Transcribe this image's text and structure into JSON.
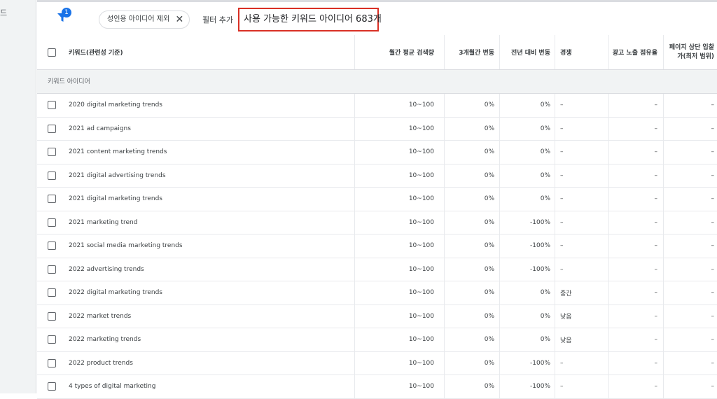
{
  "left_rail": {
    "text": "드"
  },
  "filter_bar": {
    "badge": "1",
    "chip_label": "성인용 아이디어 제외",
    "chip_close": "✕",
    "add_filter": "필터 추가",
    "available_count": "사용 가능한 키워드 아이디어 683개"
  },
  "table": {
    "headers": {
      "keyword": "키워드(관련성 기준)",
      "volume": "월간 평균 검색량",
      "three_month": "3개월간 변동",
      "yoy": "전년 대비 변동",
      "competition": "경쟁",
      "impression_share": "광고 노출 점유율",
      "top_bid": "페이지 상단 입찰가(최저 범위)"
    },
    "group_label": "키워드 아이디어",
    "rows": [
      {
        "keyword": "2020 digital marketing trends",
        "volume": "10~100",
        "three_month": "0%",
        "yoy": "0%",
        "competition": "–",
        "share": "–",
        "bid": "–"
      },
      {
        "keyword": "2021 ad campaigns",
        "volume": "10~100",
        "three_month": "0%",
        "yoy": "0%",
        "competition": "–",
        "share": "–",
        "bid": "–"
      },
      {
        "keyword": "2021 content marketing trends",
        "volume": "10~100",
        "three_month": "0%",
        "yoy": "0%",
        "competition": "–",
        "share": "–",
        "bid": "–"
      },
      {
        "keyword": "2021 digital advertising trends",
        "volume": "10~100",
        "three_month": "0%",
        "yoy": "0%",
        "competition": "–",
        "share": "–",
        "bid": "–"
      },
      {
        "keyword": "2021 digital marketing trends",
        "volume": "10~100",
        "three_month": "0%",
        "yoy": "0%",
        "competition": "–",
        "share": "–",
        "bid": "–"
      },
      {
        "keyword": "2021 marketing trend",
        "volume": "10~100",
        "three_month": "0%",
        "yoy": "-100%",
        "competition": "–",
        "share": "–",
        "bid": "–"
      },
      {
        "keyword": "2021 social media marketing trends",
        "volume": "10~100",
        "three_month": "0%",
        "yoy": "-100%",
        "competition": "–",
        "share": "–",
        "bid": "–"
      },
      {
        "keyword": "2022 advertising trends",
        "volume": "10~100",
        "three_month": "0%",
        "yoy": "-100%",
        "competition": "–",
        "share": "–",
        "bid": "–"
      },
      {
        "keyword": "2022 digital marketing trends",
        "volume": "10~100",
        "three_month": "0%",
        "yoy": "0%",
        "competition": "중간",
        "share": "–",
        "bid": "–"
      },
      {
        "keyword": "2022 market trends",
        "volume": "10~100",
        "three_month": "0%",
        "yoy": "0%",
        "competition": "낮음",
        "share": "–",
        "bid": "–"
      },
      {
        "keyword": "2022 marketing trends",
        "volume": "10~100",
        "three_month": "0%",
        "yoy": "0%",
        "competition": "낮음",
        "share": "–",
        "bid": "–"
      },
      {
        "keyword": "2022 product trends",
        "volume": "10~100",
        "three_month": "0%",
        "yoy": "-100%",
        "competition": "–",
        "share": "–",
        "bid": "–"
      },
      {
        "keyword": "4 types of digital marketing",
        "volume": "10~100",
        "three_month": "0%",
        "yoy": "-100%",
        "competition": "–",
        "share": "–",
        "bid": "–"
      }
    ]
  }
}
